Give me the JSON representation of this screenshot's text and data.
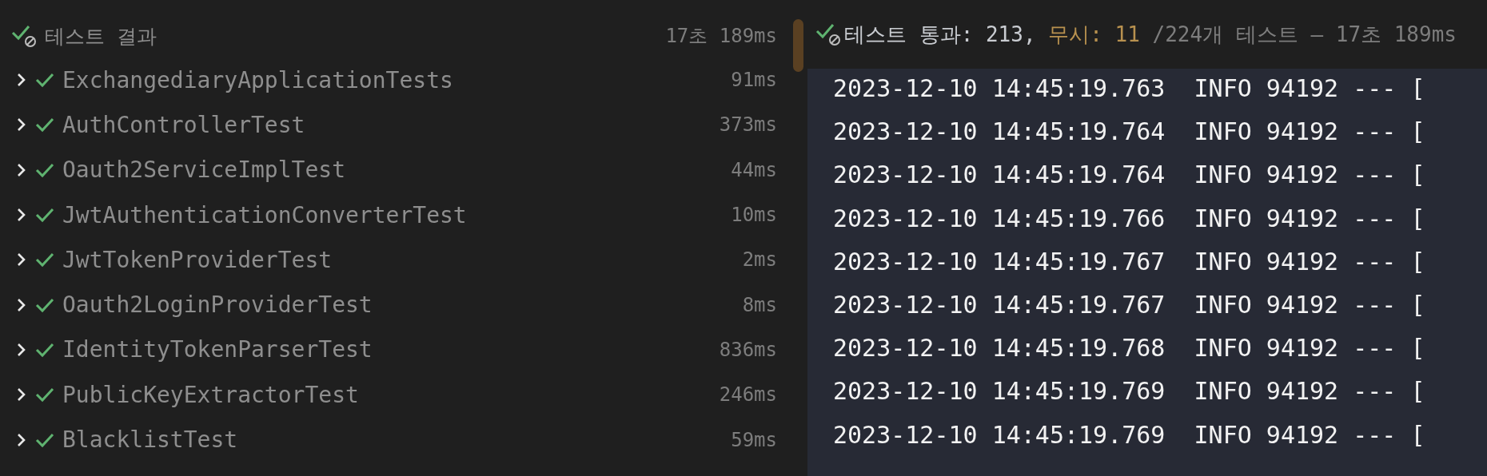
{
  "results": {
    "title": "테스트 결과",
    "kind": "mixed",
    "duration": "17초 189ms",
    "items": [
      {
        "name": "ExchangediaryApplicationTests",
        "duration": "91ms",
        "kind": "passed",
        "expanded": false
      },
      {
        "name": "AuthControllerTest",
        "duration": "373ms",
        "kind": "passed",
        "expanded": false
      },
      {
        "name": "Oauth2ServiceImplTest",
        "duration": "44ms",
        "kind": "passed",
        "expanded": false
      },
      {
        "name": "JwtAuthenticationConverterTest",
        "duration": "10ms",
        "kind": "passed",
        "expanded": false
      },
      {
        "name": "JwtTokenProviderTest",
        "duration": "2ms",
        "kind": "passed",
        "expanded": false
      },
      {
        "name": "Oauth2LoginProviderTest",
        "duration": "8ms",
        "kind": "passed",
        "expanded": false
      },
      {
        "name": "IdentityTokenParserTest",
        "duration": "836ms",
        "kind": "passed",
        "expanded": false
      },
      {
        "name": "PublicKeyExtractorTest",
        "duration": "246ms",
        "kind": "passed",
        "expanded": false
      },
      {
        "name": "BlacklistTest",
        "duration": "59ms",
        "kind": "passed",
        "expanded": false
      }
    ]
  },
  "console": {
    "kind": "mixed",
    "summary": {
      "passed": "테스트 통과: 213,",
      "ignored": "무시: 11",
      "total": "/224개 테스트 — 17초 189ms"
    },
    "lines": [
      "2023-12-10 14:45:19.763  INFO 94192 --- [",
      "2023-12-10 14:45:19.764  INFO 94192 --- [",
      "2023-12-10 14:45:19.764  INFO 94192 --- [",
      "2023-12-10 14:45:19.766  INFO 94192 --- [",
      "2023-12-10 14:45:19.767  INFO 94192 --- [",
      "2023-12-10 14:45:19.767  INFO 94192 --- [",
      "2023-12-10 14:45:19.768  INFO 94192 --- [",
      "2023-12-10 14:45:19.769  INFO 94192 --- [",
      "2023-12-10 14:45:19.769  INFO 94192 --- ["
    ]
  }
}
